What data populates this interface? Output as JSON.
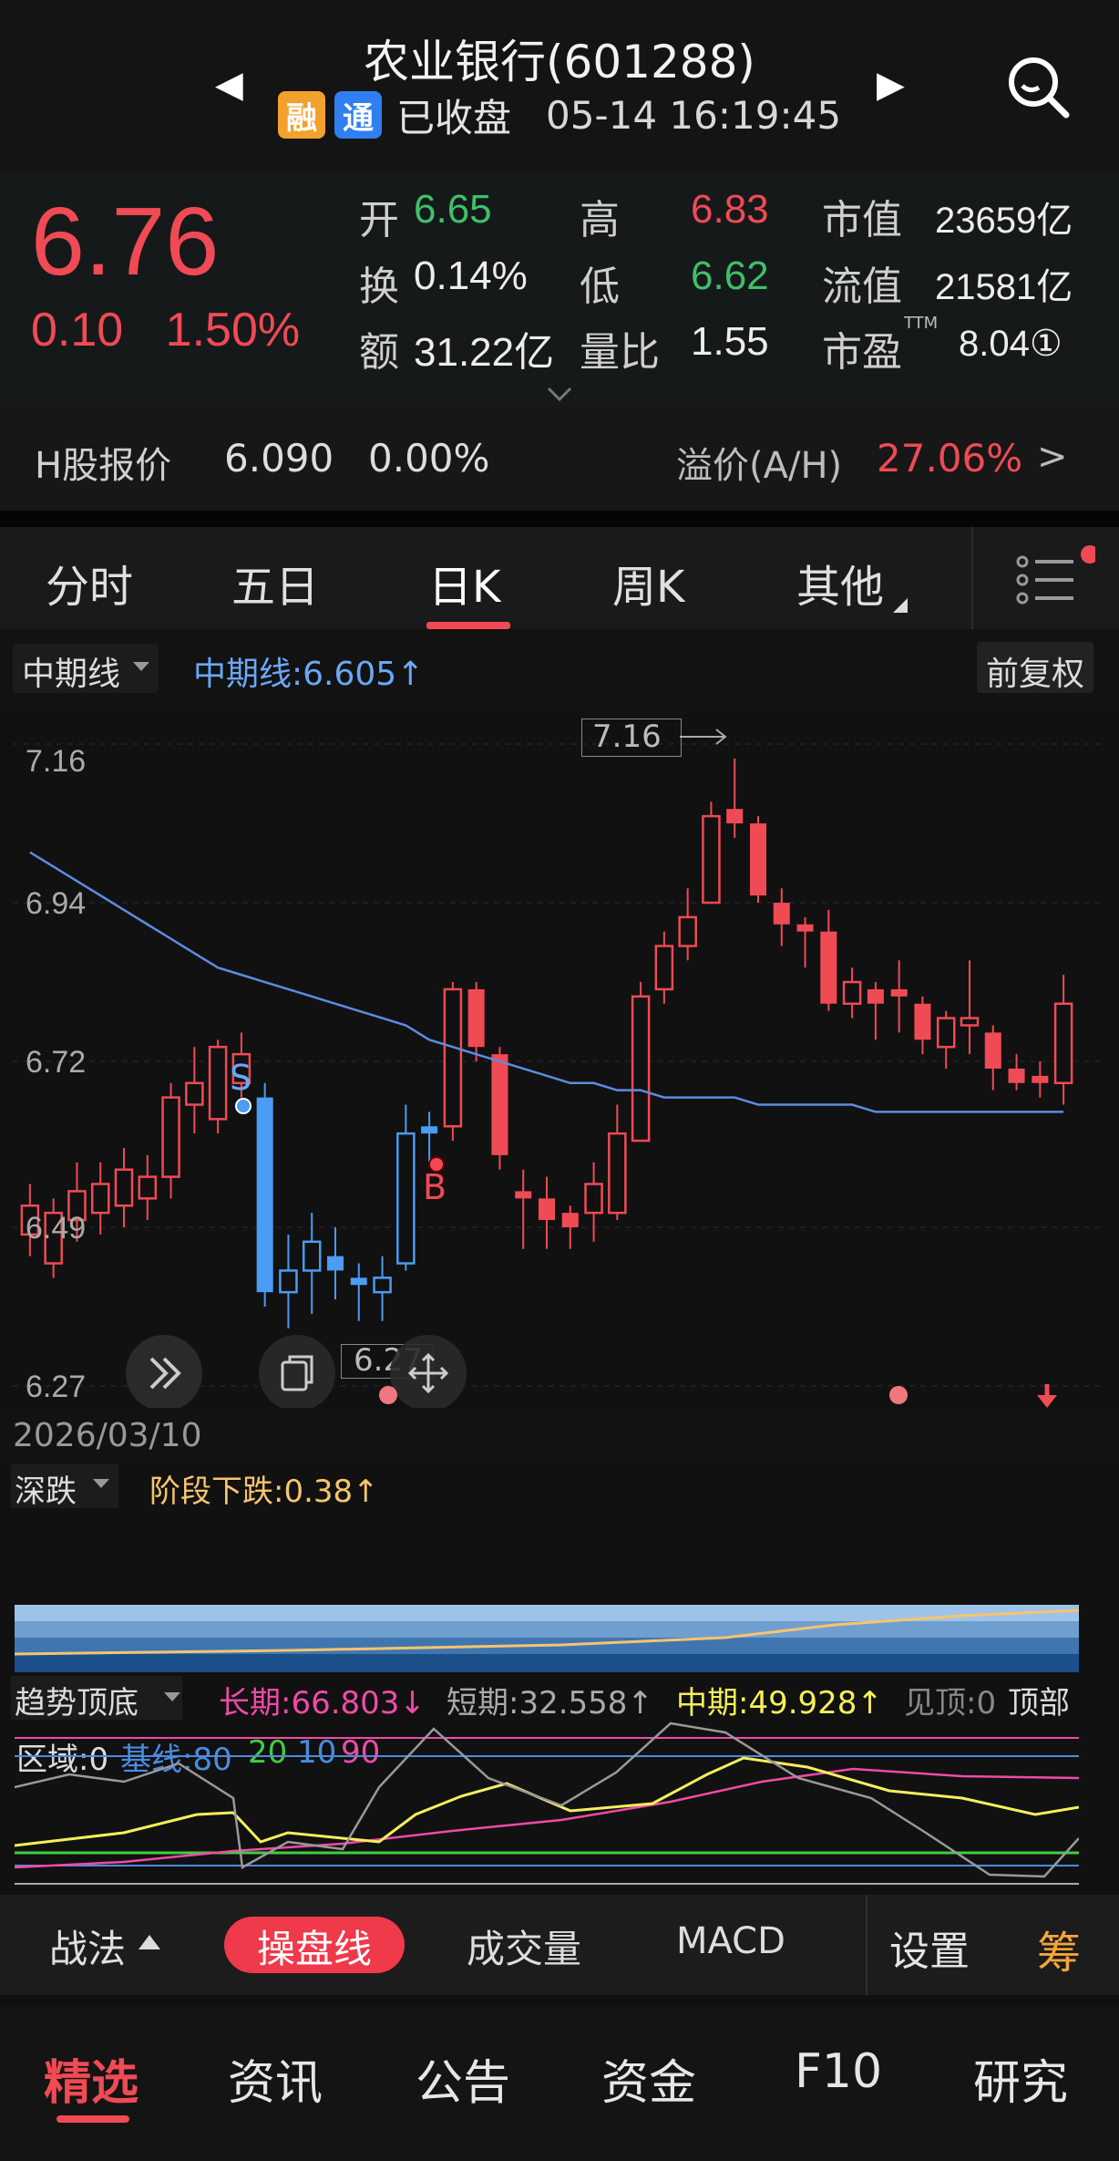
{
  "header": {
    "title": "农业银行(601288)",
    "tag_rong": "融",
    "tag_tong": "通",
    "status": "已收盘",
    "time": "05-14 16:19:45"
  },
  "quote": {
    "price": "6.76",
    "change": "0.10",
    "change_pct": "1.50%",
    "open_label": "开",
    "open": "6.65",
    "high_label": "高",
    "high": "6.83",
    "mktcap_label": "市值",
    "mktcap": "23659亿",
    "turnover_label": "换",
    "turnover": "0.14%",
    "low_label": "低",
    "low": "6.62",
    "float_label": "流值",
    "float": "21581亿",
    "amount_label": "额",
    "amount": "31.22亿",
    "volratio_label": "量比",
    "volratio": "1.55",
    "pe_label": "市盈",
    "pe_sup": "TTM",
    "pe": "8.04①"
  },
  "hshare": {
    "label": "H股报价",
    "price": "6.090",
    "pct": "0.00%",
    "premium_label": "溢价(A/H)",
    "premium": "27.06%",
    "more": ">"
  },
  "tabs": [
    "分时",
    "五日",
    "日K",
    "周K",
    "其他"
  ],
  "chart": {
    "indicator_name": "中期线",
    "indicator_value": "中期线:6.605↑",
    "adjust": "前复权",
    "date_label": "2026/03/10",
    "peak_label": "7.16",
    "trough_label": "6.27",
    "signal_s": "S",
    "signal_b": "B"
  },
  "chart_data": {
    "type": "candlestick",
    "ylim": [
      6.27,
      7.16
    ],
    "yticks": [
      "7.16",
      "6.94",
      "6.72",
      "6.49",
      "6.27"
    ],
    "candles": [
      [
        6.48,
        6.52,
        6.45,
        6.55,
        "u"
      ],
      [
        6.44,
        6.51,
        6.42,
        6.53,
        "u"
      ],
      [
        6.5,
        6.54,
        6.47,
        6.58,
        "u"
      ],
      [
        6.51,
        6.55,
        6.48,
        6.58,
        "u"
      ],
      [
        6.52,
        6.57,
        6.49,
        6.6,
        "u"
      ],
      [
        6.53,
        6.56,
        6.5,
        6.59,
        "u"
      ],
      [
        6.56,
        6.67,
        6.53,
        6.69,
        "u"
      ],
      [
        6.66,
        6.69,
        6.62,
        6.74,
        "u"
      ],
      [
        6.64,
        6.74,
        6.62,
        6.75,
        "u"
      ],
      [
        6.69,
        6.73,
        6.67,
        6.76,
        "u"
      ],
      [
        6.67,
        6.4,
        6.38,
        6.69,
        "d"
      ],
      [
        6.4,
        6.43,
        6.35,
        6.48,
        "u"
      ],
      [
        6.43,
        6.47,
        6.37,
        6.51,
        "u"
      ],
      [
        6.43,
        6.45,
        6.39,
        6.49,
        "d"
      ],
      [
        6.41,
        6.42,
        6.36,
        6.44,
        "d"
      ],
      [
        6.4,
        6.42,
        6.36,
        6.45,
        "u"
      ],
      [
        6.44,
        6.62,
        6.43,
        6.66,
        "u"
      ],
      [
        6.62,
        6.63,
        6.58,
        6.65,
        "d"
      ],
      [
        6.63,
        6.82,
        6.61,
        6.83,
        "u"
      ],
      [
        6.82,
        6.74,
        6.72,
        6.83,
        "d"
      ],
      [
        6.73,
        6.59,
        6.57,
        6.74,
        "d"
      ],
      [
        6.54,
        6.53,
        6.46,
        6.57,
        "d"
      ],
      [
        6.53,
        6.5,
        6.46,
        6.56,
        "d"
      ],
      [
        6.51,
        6.49,
        6.46,
        6.52,
        "d"
      ],
      [
        6.51,
        6.55,
        6.47,
        6.58,
        "u"
      ],
      [
        6.51,
        6.62,
        6.5,
        6.66,
        "u"
      ],
      [
        6.61,
        6.81,
        6.61,
        6.83,
        "u"
      ],
      [
        6.82,
        6.88,
        6.8,
        6.9,
        "u"
      ],
      [
        6.88,
        6.92,
        6.86,
        6.96,
        "u"
      ],
      [
        6.94,
        7.06,
        6.94,
        7.08,
        "u"
      ],
      [
        7.07,
        7.05,
        7.03,
        7.14,
        "d"
      ],
      [
        7.05,
        6.95,
        6.94,
        7.06,
        "d"
      ],
      [
        6.94,
        6.91,
        6.88,
        6.96,
        "d"
      ],
      [
        6.91,
        6.9,
        6.85,
        6.92,
        "d"
      ],
      [
        6.9,
        6.8,
        6.79,
        6.93,
        "d"
      ],
      [
        6.8,
        6.83,
        6.78,
        6.85,
        "u"
      ],
      [
        6.82,
        6.8,
        6.75,
        6.83,
        "d"
      ],
      [
        6.82,
        6.81,
        6.76,
        6.86,
        "d"
      ],
      [
        6.8,
        6.75,
        6.73,
        6.81,
        "d"
      ],
      [
        6.74,
        6.78,
        6.71,
        6.79,
        "u"
      ],
      [
        6.77,
        6.78,
        6.73,
        6.86,
        "u"
      ],
      [
        6.76,
        6.71,
        6.68,
        6.77,
        "d"
      ],
      [
        6.71,
        6.69,
        6.68,
        6.73,
        "d"
      ],
      [
        6.69,
        6.7,
        6.67,
        6.72,
        "d"
      ],
      [
        6.69,
        6.8,
        6.66,
        6.84,
        "u"
      ]
    ],
    "ma_line": [
      7.01,
      6.99,
      6.97,
      6.95,
      6.93,
      6.91,
      6.89,
      6.87,
      6.85,
      6.84,
      6.83,
      6.82,
      6.81,
      6.8,
      6.79,
      6.78,
      6.77,
      6.75,
      6.74,
      6.73,
      6.72,
      6.71,
      6.7,
      6.69,
      6.69,
      6.68,
      6.68,
      6.67,
      6.67,
      6.67,
      6.67,
      6.66,
      6.66,
      6.66,
      6.66,
      6.66,
      6.65,
      6.65,
      6.65,
      6.65,
      6.65,
      6.65,
      6.65,
      6.65,
      6.65
    ]
  },
  "sub1": {
    "name": "深跌",
    "value": "阶段下跌:0.38↑"
  },
  "sub2": {
    "name": "趋势顶底",
    "long_label": "长期:66.803↓",
    "short_label": "短期:32.558↑",
    "mid_label": "中期:49.928↑",
    "top_label": "见顶:0",
    "top_word": "顶部",
    "zone_label": "区域:0",
    "base_label": "基线:80",
    "v20": "20",
    "v10": "10",
    "v90": "90"
  },
  "toolbar": {
    "strategy": "战法",
    "active": "操盘线",
    "volume": "成交量",
    "macd": "MACD",
    "settings": "设置",
    "chip": "筹"
  },
  "nav": [
    "精选",
    "资讯",
    "公告",
    "资金",
    "F10",
    "研究"
  ],
  "colors": {
    "up": "#f04a55",
    "down": "#4a9cf5",
    "ma": "#5b8de0"
  }
}
